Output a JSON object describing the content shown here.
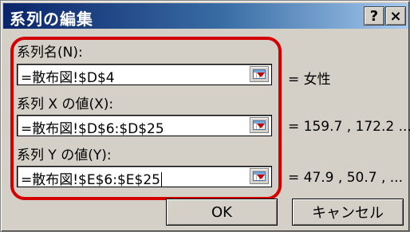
{
  "window": {
    "title": "系列の編集",
    "help_label": "?",
    "close_label": "×"
  },
  "fields": [
    {
      "label": "系列名(N):",
      "value": "=散布図!$D$4",
      "preview": "= 女性"
    },
    {
      "label": "系列 X の値(X):",
      "value": "=散布図!$D$6:$D$25",
      "preview": "= 159.7 , 172.2 ..."
    },
    {
      "label": "系列 Y の値(Y):",
      "value": "=散布図!$E$6:$E$25",
      "preview": "= 47.9 , 50.7 , ..."
    }
  ],
  "buttons": {
    "ok_label": "OK",
    "cancel_label": "キャンセル"
  },
  "colors": {
    "titlebar_start": "#0a246a",
    "titlebar_end": "#a6caf0",
    "dialog_face": "#d4d0c8",
    "highlight": "#d40000"
  }
}
